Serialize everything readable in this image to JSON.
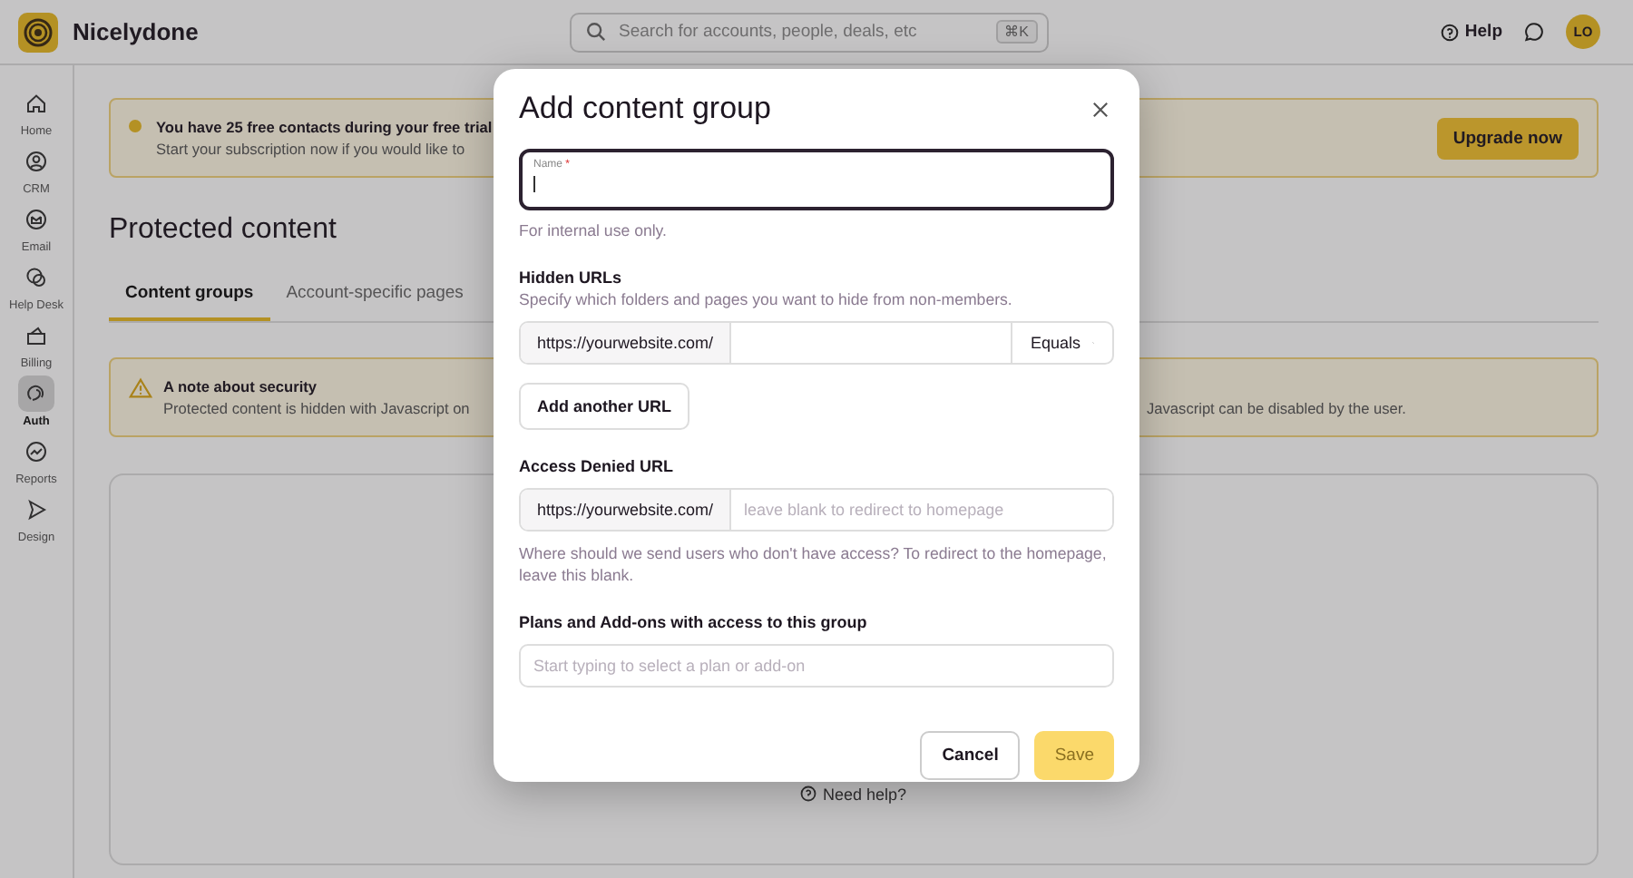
{
  "app": {
    "name": "Nicelydone"
  },
  "search": {
    "placeholder": "Search for accounts, people, deals, etc",
    "shortcut": "⌘K"
  },
  "header": {
    "help": "Help",
    "avatar": "LO"
  },
  "sidebar": {
    "items": [
      {
        "label": "Home",
        "selected": false
      },
      {
        "label": "CRM",
        "selected": false
      },
      {
        "label": "Email",
        "selected": false
      },
      {
        "label": "Help Desk",
        "selected": false
      },
      {
        "label": "Billing",
        "selected": false
      },
      {
        "label": "Auth",
        "selected": true
      },
      {
        "label": "Reports",
        "selected": false
      },
      {
        "label": "Design",
        "selected": false
      }
    ]
  },
  "trial_banner": {
    "title": "You have 25 free contacts during your free trial",
    "text": "Start your subscription now if you would like to",
    "button": "Upgrade now"
  },
  "page": {
    "title": "Protected content"
  },
  "tabs": [
    {
      "label": "Content groups",
      "selected": true
    },
    {
      "label": "Account-specific pages",
      "selected": false
    }
  ],
  "security_note": {
    "title": "A note about security",
    "text_left": "Protected content is hidden with Javascript on",
    "text_right": "Javascript can be disabled by the user."
  },
  "empty_state": {
    "help_link": "Need help?"
  },
  "modal": {
    "title": "Add content group",
    "name_field": {
      "label": "Name",
      "required_mark": "*",
      "hint": "For internal use only."
    },
    "hidden_urls": {
      "label": "Hidden URLs",
      "description": "Specify which folders and pages you want to hide from non-members.",
      "prefix": "https://yourwebsite.com/",
      "match": "Equals",
      "add_button": "Add another URL"
    },
    "access_denied": {
      "label": "Access Denied URL",
      "prefix": "https://yourwebsite.com/",
      "placeholder": "leave blank to redirect to homepage",
      "hint": "Where should we send users who don't have access? To redirect to the homepage, leave this blank."
    },
    "plans": {
      "label": "Plans and Add-ons with access to this group",
      "placeholder": "Start typing to select a plan or add-on"
    },
    "cancel": "Cancel",
    "save": {
      "label": "Save",
      "disabled": true
    }
  }
}
